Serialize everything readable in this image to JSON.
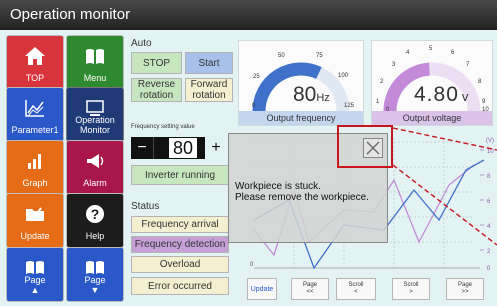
{
  "title": "Operation monitor",
  "nav": [
    {
      "label": "TOP",
      "icon": "home-icon"
    },
    {
      "label": "Menu",
      "icon": "book-icon"
    },
    {
      "label": "Parameter1",
      "icon": "chart-icon"
    },
    {
      "label": "Operation Monitor",
      "icon": "monitor-icon"
    },
    {
      "label": "Graph",
      "icon": "bar-graph-icon"
    },
    {
      "label": "Alarm",
      "icon": "megaphone-icon"
    },
    {
      "label": "Update",
      "icon": "folder-icon"
    },
    {
      "label": "Help",
      "icon": "question-icon"
    },
    {
      "label": "Page",
      "icon": "page-up-icon"
    },
    {
      "label": "Page",
      "icon": "page-down-icon"
    }
  ],
  "auto": {
    "label": "Auto",
    "stop": "STOP",
    "start": "Start",
    "reverse": "Reverse rotation",
    "forward": "Forward rotation",
    "freq_setting_label": "Frequency setting value",
    "minus": "−",
    "freq_value": "80",
    "plus": "+",
    "inverter_status": "Inverter running"
  },
  "status": {
    "label": "Status",
    "items": [
      "Frequency arrival",
      "Frequency detection",
      "Overload",
      "Error occurred"
    ]
  },
  "gauge_freq": {
    "ticks": [
      "0",
      "25",
      "50",
      "75",
      "100",
      "125"
    ],
    "value": "80",
    "unit": "Hz",
    "caption": "Output frequency",
    "level": 0.64
  },
  "gauge_volt": {
    "ticks": [
      "0",
      "1",
      "2",
      "3",
      "4",
      "5",
      "6",
      "7",
      "8",
      "9",
      "10"
    ],
    "value": "4.80",
    "unit": "v",
    "caption": "Output voltage",
    "level": 0.48
  },
  "graph": {
    "unit_label": "(V)",
    "y_ticks": [
      "10",
      "8",
      "6",
      "4",
      "2",
      "0"
    ]
  },
  "dialog": {
    "line1": "Workpiece is stuck.",
    "line2": "Please remove the workpiece."
  },
  "footer": {
    "update": "Update",
    "buttons": [
      {
        "top": "Page",
        "bottom": "<<"
      },
      {
        "top": "Scroll",
        "bottom": "<"
      },
      {
        "top": "Scroll",
        "bottom": ">"
      },
      {
        "top": "Page",
        "bottom": ">>"
      }
    ]
  },
  "colors": {
    "accent_red": "#c8141e",
    "gauge_blue": "#3f71c9",
    "gauge_purple": "#c28ad8"
  }
}
